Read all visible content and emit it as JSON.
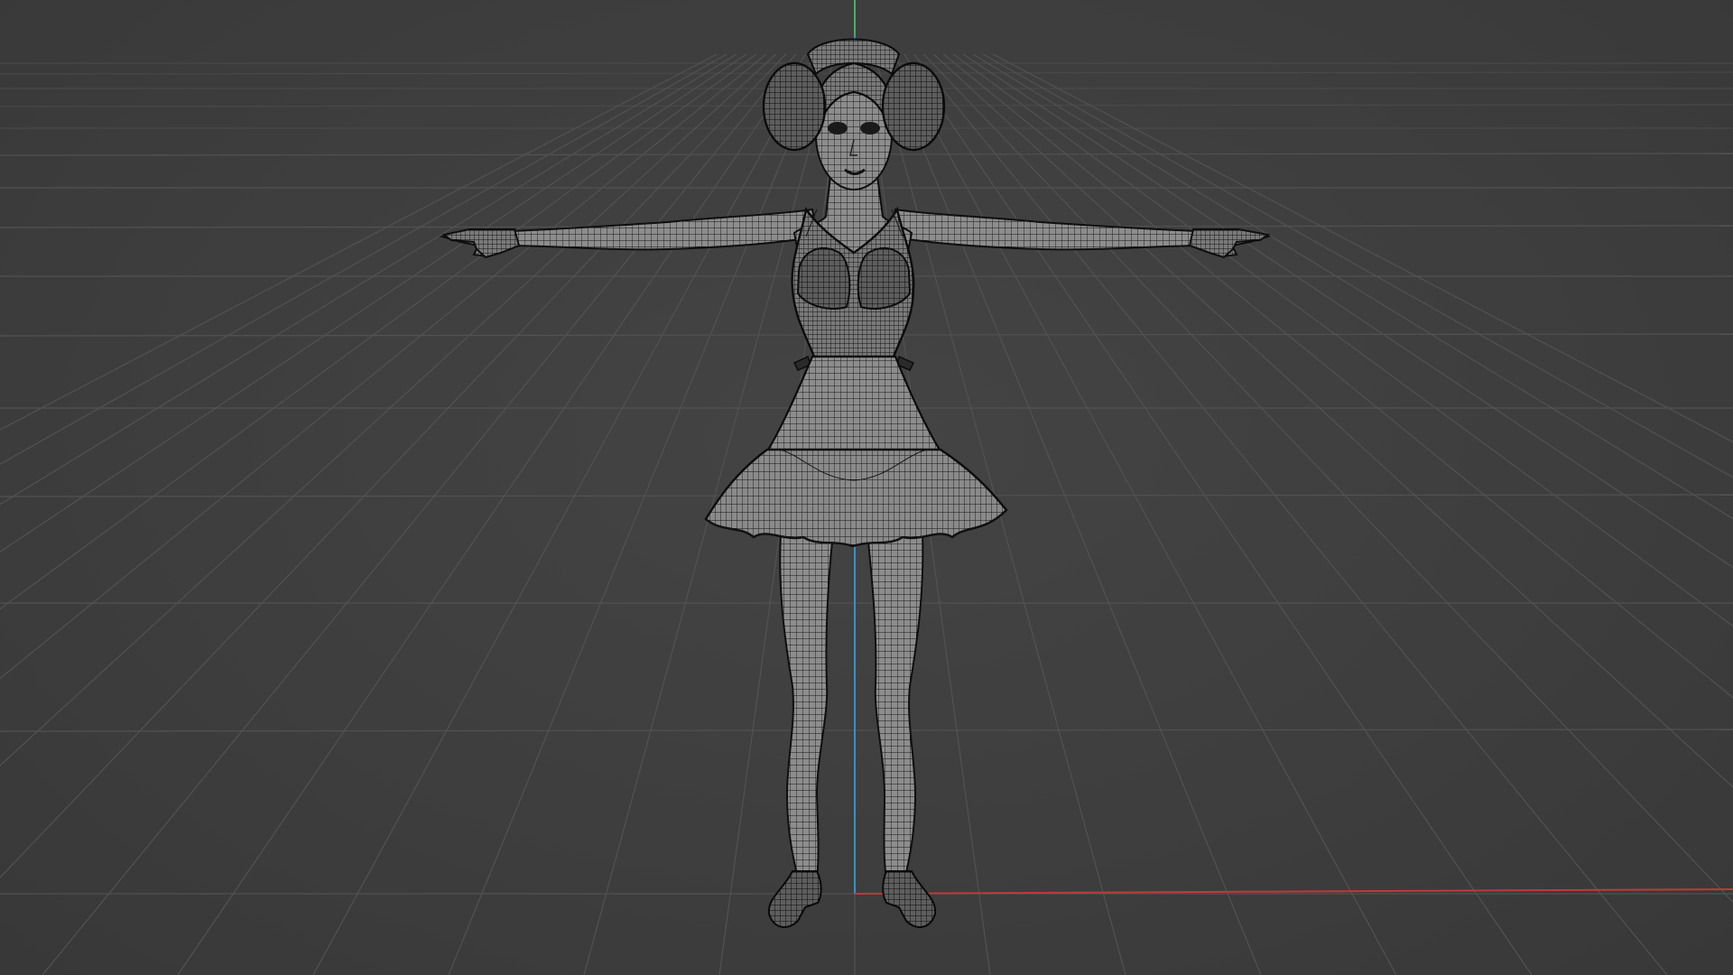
{
  "viewport": {
    "mode": "wireframe",
    "object": "character-mesh",
    "pose": "t-pose"
  },
  "axes": {
    "x_color": "#c0393b",
    "z_color": "#3f8fbf",
    "y_color": "#4fa86a"
  },
  "colors": {
    "background": "#3d3d3d",
    "grid": "#525252",
    "wire": "#151515",
    "surface": "#8a8a8a"
  }
}
